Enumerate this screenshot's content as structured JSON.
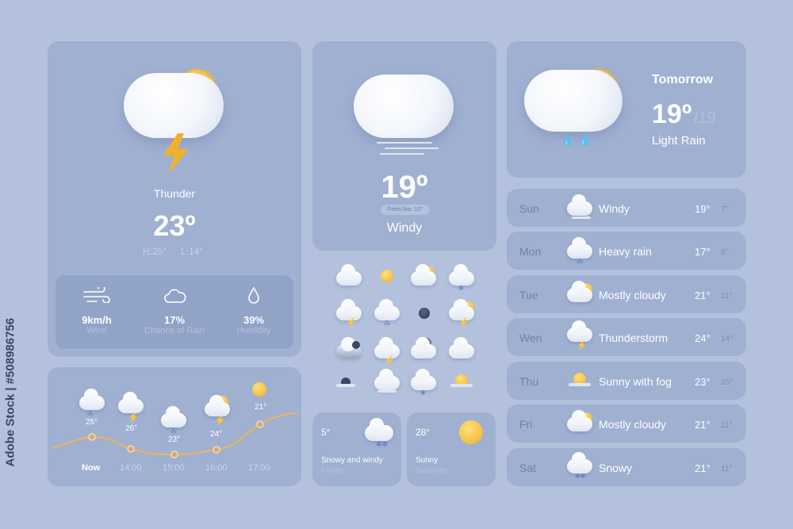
{
  "watermark": {
    "vertical_text": "Adobe Stock | #508986756",
    "stamp": "Adobe Stock"
  },
  "main": {
    "condition": "Thunder",
    "temp": "23º",
    "high": "H:25°",
    "low": "L:14°",
    "icon": "thunder-cloud-sun-icon",
    "stats": [
      {
        "value": "9km/h",
        "label": "Wind",
        "icon": "wind-icon"
      },
      {
        "value": "17%",
        "label": "Chance of Rain",
        "icon": "cloud-icon"
      },
      {
        "value": "39%",
        "label": "Humidity",
        "icon": "droplet-icon"
      }
    ]
  },
  "hourly": {
    "points": [
      {
        "time": "Now",
        "temp": "25°",
        "icon": "rain-cloud-icon",
        "value": 25
      },
      {
        "time": "14:00",
        "temp": "26°",
        "icon": "thunder-cloud-icon",
        "value": 26
      },
      {
        "time": "15:00",
        "temp": "23°",
        "icon": "rain-cloud-icon",
        "value": 23
      },
      {
        "time": "16:00",
        "temp": "24°",
        "icon": "thunder-sun-cloud-icon",
        "value": 24
      },
      {
        "time": "17:00",
        "temp": "21°",
        "icon": "sun-icon",
        "value": 21
      }
    ]
  },
  "center": {
    "temp": "19º",
    "feels_like": "Feels like: 15°",
    "condition": "Windy",
    "icon": "windy-cloud-icon"
  },
  "icon_grid": [
    "cloud-icon",
    "sun-icon",
    "sun-cloud-icon",
    "snow-cloud-icon",
    "thunder-cloud-icon",
    "rain-cloud-icon",
    "moon-icon",
    "thunder-sun-cloud-icon",
    "dark-cloud-moon-icon",
    "thunder-rain-cloud-icon",
    "moon-cloud-icon",
    "cloud-icon",
    "moon-fog-icon",
    "rain-fog-icon",
    "snow-cloud-icon",
    "sun-fog-icon"
  ],
  "mini_cards": [
    {
      "temp": "5°",
      "condition": "Snowy and windy",
      "day": "Friday",
      "icon": "snow-cloud-icon"
    },
    {
      "temp": "28°",
      "condition": "Sunny",
      "day": "Saturday",
      "icon": "sun-icon"
    }
  ],
  "tomorrow": {
    "title": "Tomorrow",
    "temp": "19º",
    "low": "/19",
    "condition": "Light Rain",
    "icon": "rain-sun-cloud-icon"
  },
  "forecast": [
    {
      "day": "Sun",
      "desc": "Windy",
      "hi": "19°",
      "lo": "7°",
      "icon": "windy-cloud-icon"
    },
    {
      "day": "Mon",
      "desc": "Heavy rain",
      "hi": "17°",
      "lo": "8°",
      "icon": "rain-cloud-icon"
    },
    {
      "day": "Tue",
      "desc": "Mostly cloudy",
      "hi": "21°",
      "lo": "11°",
      "icon": "sun-cloud-icon"
    },
    {
      "day": "Wen",
      "desc": "Thunderstorm",
      "hi": "24°",
      "lo": "14°",
      "icon": "thunder-cloud-icon"
    },
    {
      "day": "Thu",
      "desc": "Sunny with fog",
      "hi": "23°",
      "lo": "15°",
      "icon": "sun-fog-icon"
    },
    {
      "day": "Fri",
      "desc": "Mostly cloudy",
      "hi": "21°",
      "lo": "11°",
      "icon": "sun-cloud-icon"
    },
    {
      "day": "Sat",
      "desc": "Snowy",
      "hi": "21°",
      "lo": "11°",
      "icon": "snow-cloud-icon"
    }
  ],
  "colors": {
    "background": "#b3c1dc",
    "card": "#9fb0d1",
    "accent_line": "#f0b35a",
    "muted_text": "#7b8db5"
  }
}
